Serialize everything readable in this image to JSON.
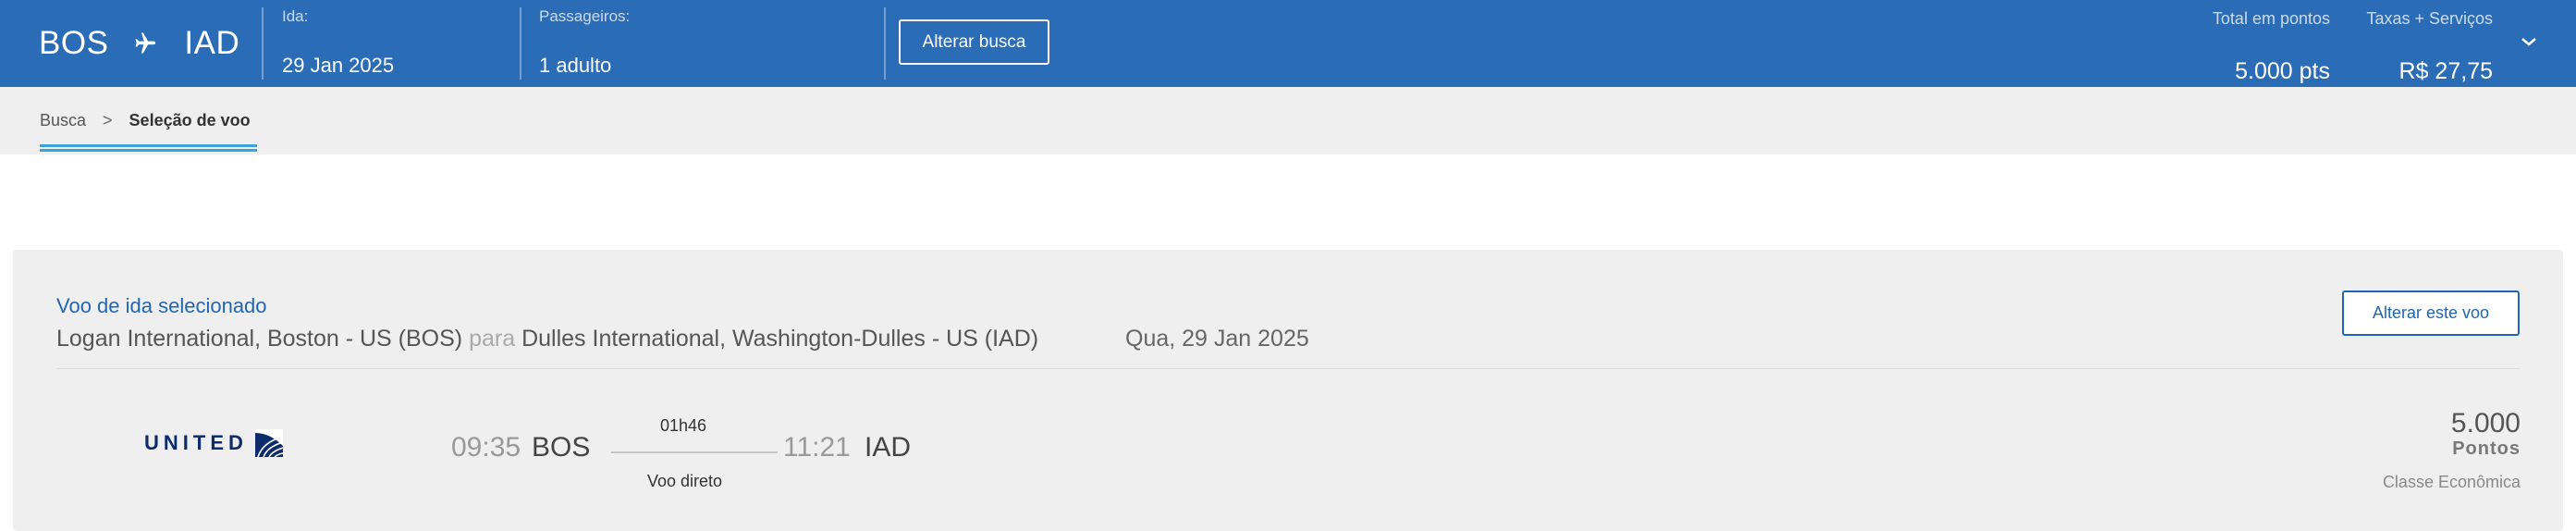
{
  "header": {
    "origin": "BOS",
    "destination": "IAD",
    "departure_label": "Ida:",
    "departure_value": "29 Jan 2025",
    "passengers_label": "Passageiros:",
    "passengers_value": "1 adulto",
    "change_search_label": "Alterar busca",
    "total_points_label": "Total em pontos",
    "total_points_value": "5.000 pts",
    "fees_label": "Taxas + Serviços",
    "fees_value": "R$ 27,75",
    "colors": {
      "bar": "#2b6cb6"
    }
  },
  "breadcrumb": {
    "items": [
      "Busca",
      "Seleção de voo"
    ],
    "separator": ">",
    "underline_color": "#3aa4d8"
  },
  "selected_flight": {
    "title": "Voo de ida selecionado",
    "origin_airport": "Logan International, Boston - US (BOS)",
    "connector": "para",
    "destination_airport": "Dulles International, Washington-Dulles - US (IAD)",
    "date": "Qua, 29 Jan 2025",
    "change_flight_label": "Alterar este voo",
    "airline_name": "UNITED",
    "airline_logo_icon": "united-globe-icon",
    "departure_time": "09:35",
    "departure_code": "BOS",
    "duration": "01h46",
    "stops": "Voo direto",
    "arrival_time": "11:21",
    "arrival_code": "IAD",
    "points": "5.000",
    "points_label": "Pontos",
    "cabin": "Classe Econômica",
    "accent_color": "#2166b0"
  }
}
